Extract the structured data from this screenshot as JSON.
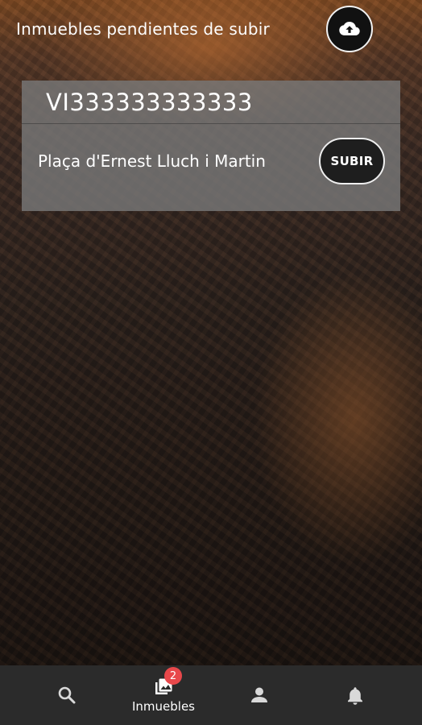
{
  "header": {
    "title": "Inmuebles pendientes de subir",
    "upload_icon": "cloud-upload-icon"
  },
  "pending_items": [
    {
      "code": "VI333333333333",
      "address": "Plaça d'Ernest Lluch i Martin",
      "action_label": "SUBIR"
    }
  ],
  "bottom_nav": {
    "items": [
      {
        "name": "search",
        "icon": "search-icon",
        "label": ""
      },
      {
        "name": "inmuebles",
        "icon": "photo-library-icon",
        "label": "Inmuebles",
        "badge": "2",
        "active": true
      },
      {
        "name": "profile",
        "icon": "person-icon",
        "label": ""
      },
      {
        "name": "alerts",
        "icon": "bell-icon",
        "label": ""
      }
    ]
  },
  "colors": {
    "card_background": "#787878",
    "nav_background": "#2b2b2b",
    "badge": "#e8484b",
    "button_dark": "#1e1e1e"
  }
}
